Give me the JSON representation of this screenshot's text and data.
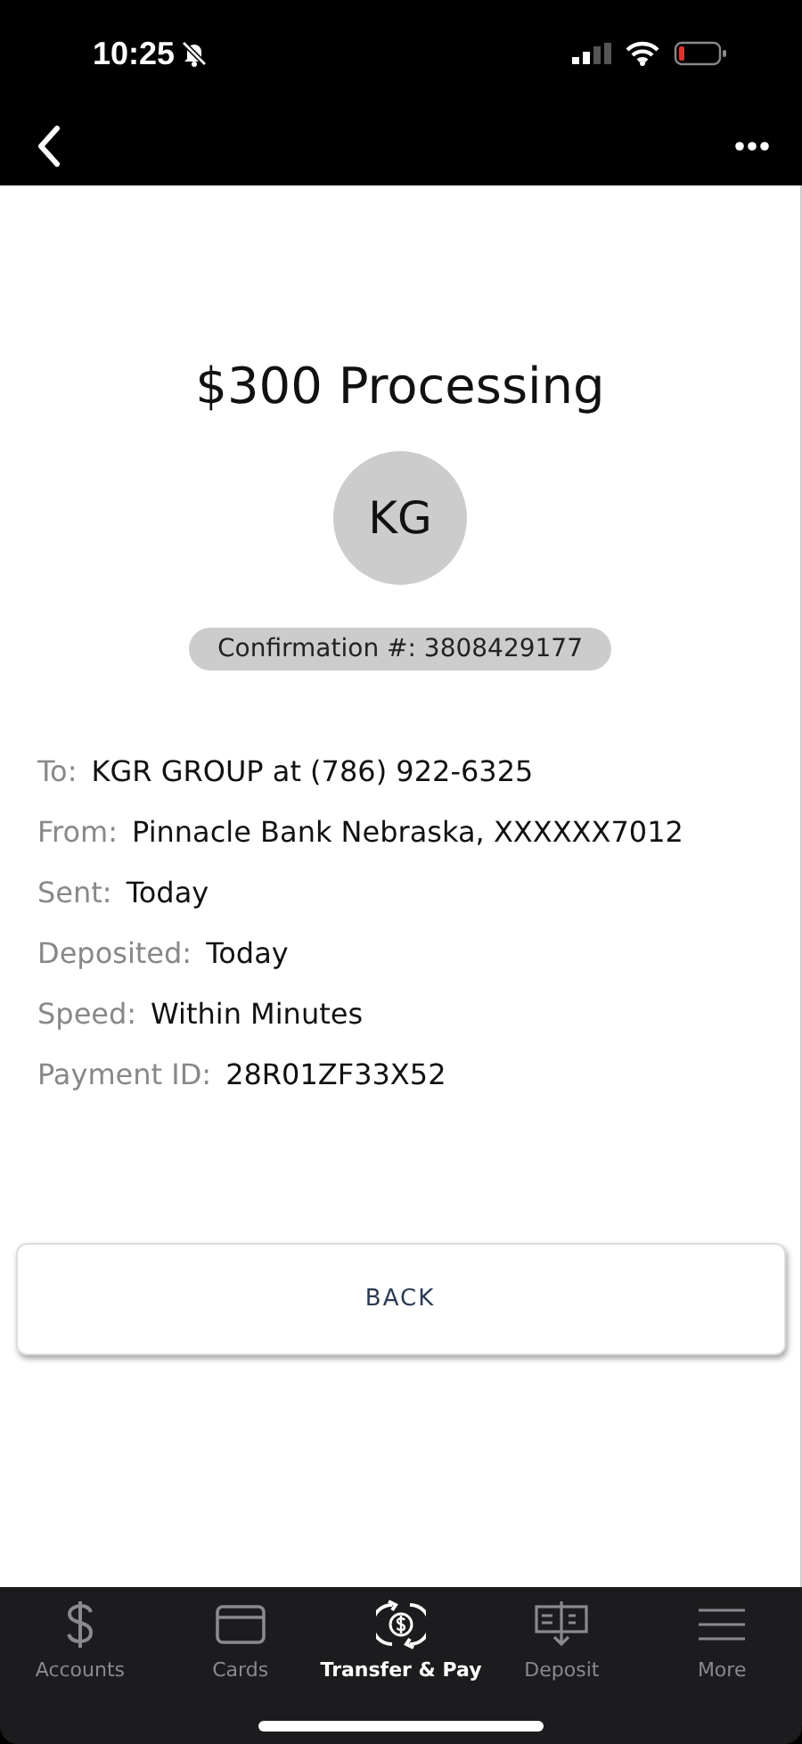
{
  "status_bar": {
    "time": "10:25",
    "silenced": true
  },
  "title": "$300 Processing",
  "avatar": {
    "initials": "KG"
  },
  "confirmation": "Confirmation #: 3808429177",
  "details": [
    {
      "label": "To:",
      "value": "KGR GROUP at (786) 922-6325"
    },
    {
      "label": "From:",
      "value": "Pinnacle Bank Nebraska, XXXXXX7012"
    },
    {
      "label": "Sent:",
      "value": "Today"
    },
    {
      "label": "Deposited:",
      "value": "Today"
    },
    {
      "label": "Speed:",
      "value": "Within Minutes"
    },
    {
      "label": "Payment ID:",
      "value": "28R01ZF33X52"
    }
  ],
  "back_button": "BACK",
  "tabs": [
    {
      "label": "Accounts",
      "kind": "dollar",
      "selected": false
    },
    {
      "label": "Cards",
      "kind": "card",
      "selected": false
    },
    {
      "label": "Transfer & Pay",
      "kind": "transfer",
      "selected": true
    },
    {
      "label": "Deposit",
      "kind": "check",
      "selected": false
    },
    {
      "label": "More",
      "kind": "menu",
      "selected": false
    }
  ]
}
